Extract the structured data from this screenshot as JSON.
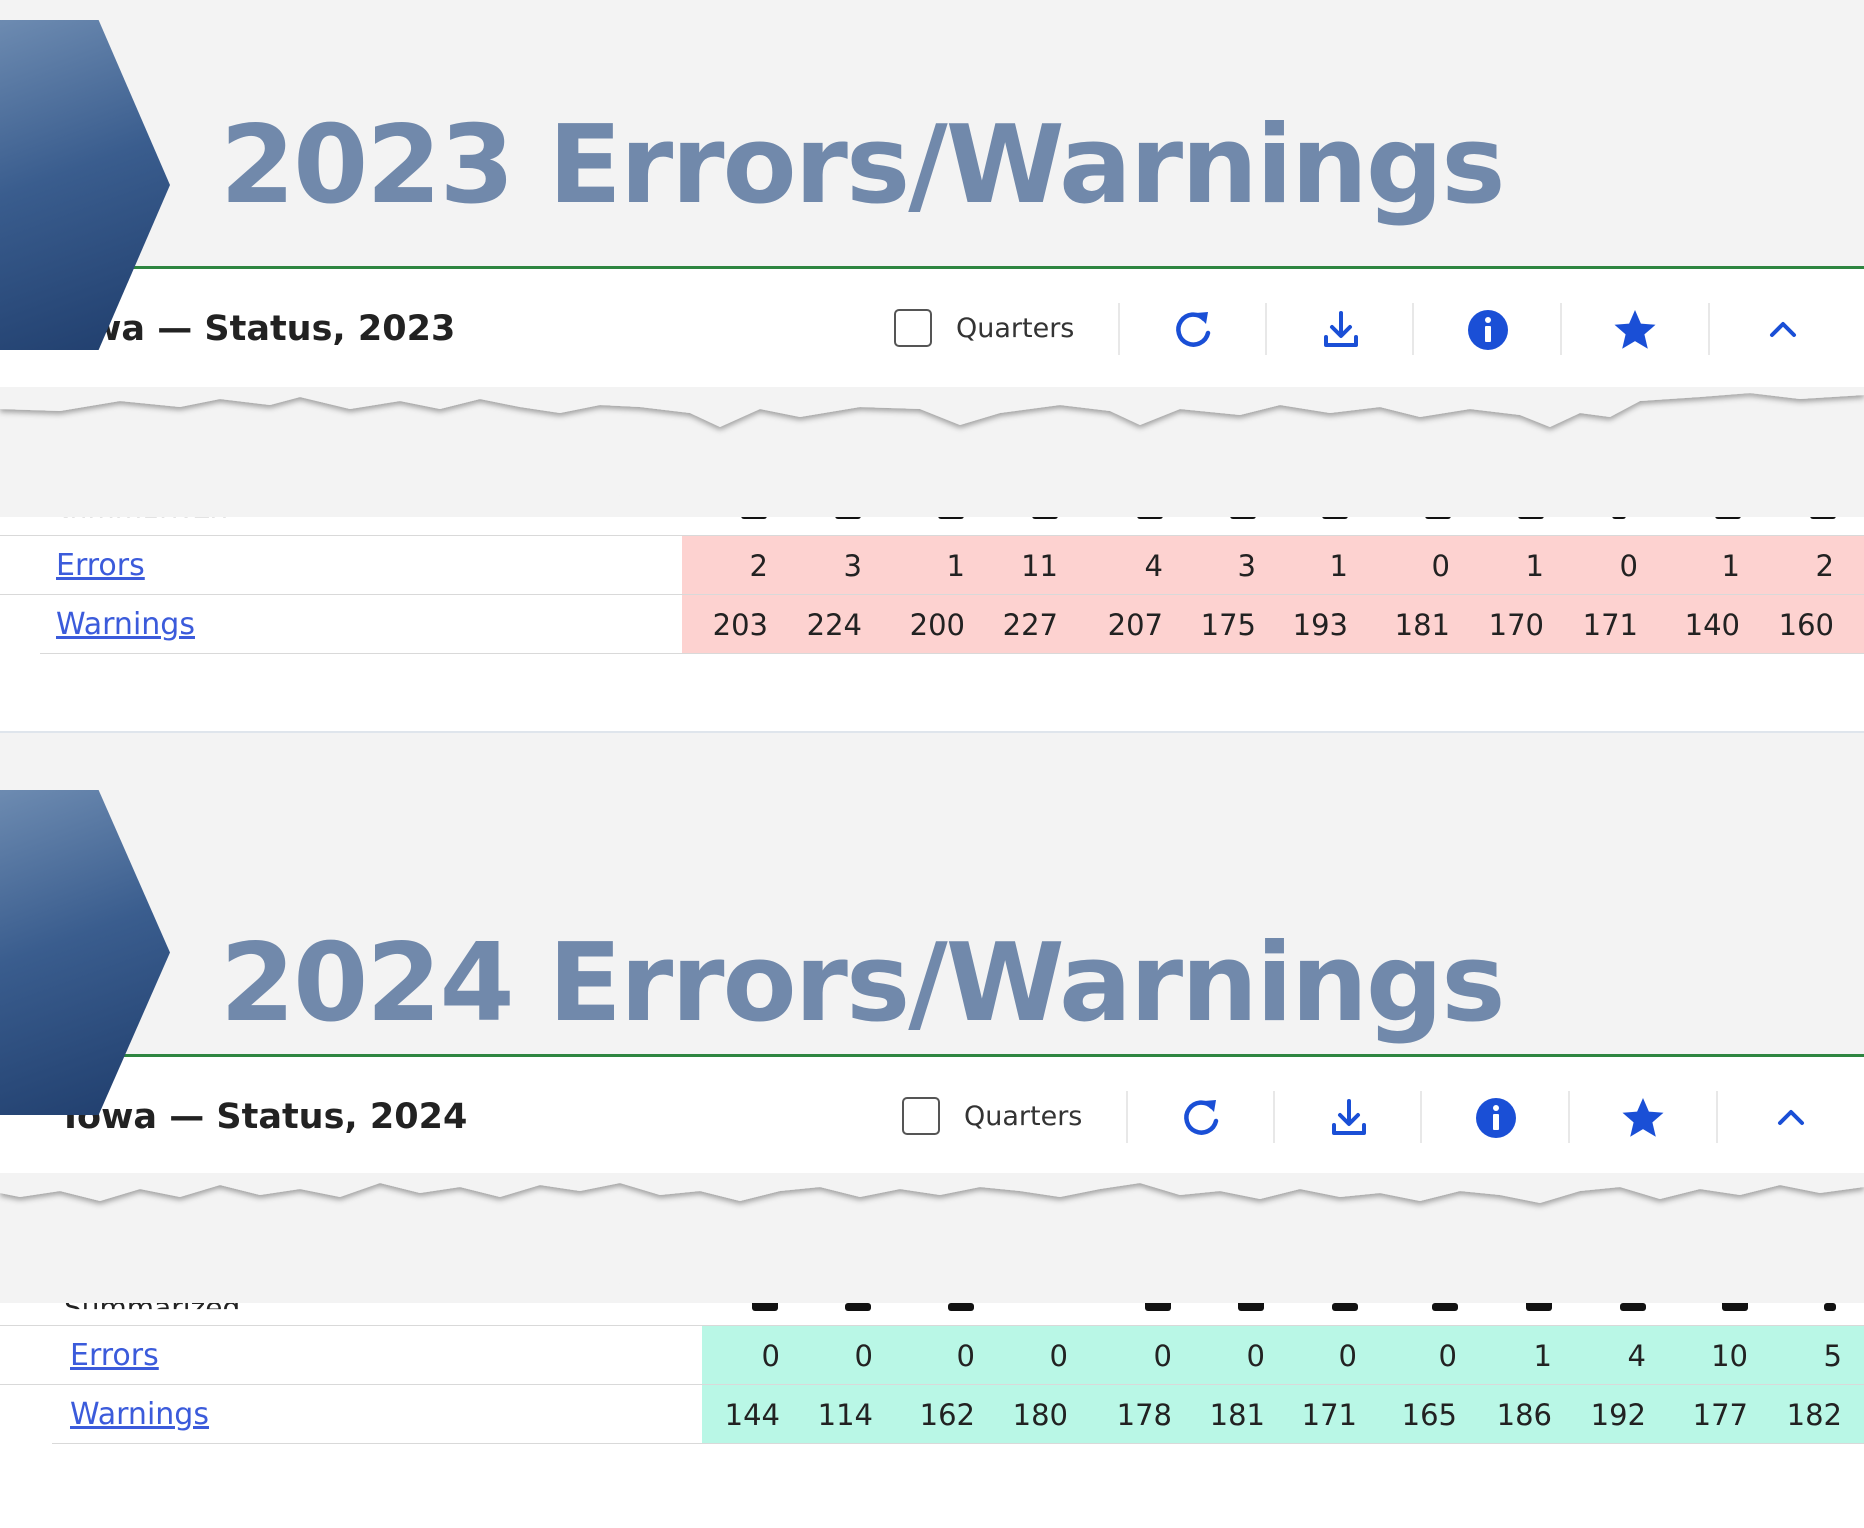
{
  "colors": {
    "heading": "#7189ab",
    "accent_blue": "#1a4fd6",
    "errors_2023_bg": "#fdd2d0",
    "errors_2024_bg": "#b9f7e6",
    "panel_top_border": "#2e8540",
    "link": "#3b5bdb"
  },
  "sections": [
    {
      "heading": "2023 Errors/Warnings",
      "panel_title": "Iowa — Status, 2023",
      "quarters_label": "Quarters",
      "quarters_checked": false,
      "toolbar_icons": [
        "refresh-icon",
        "download-icon",
        "info-icon",
        "star-icon",
        "chevron-up-icon"
      ],
      "partial_label": "Summarized",
      "rows": [
        {
          "label": "Errors",
          "values": [
            "2",
            "3",
            "1",
            "11",
            "4",
            "3",
            "1",
            "0",
            "1",
            "0",
            "1",
            "2"
          ]
        },
        {
          "label": "Warnings",
          "values": [
            "203",
            "224",
            "200",
            "227",
            "207",
            "175",
            "193",
            "181",
            "170",
            "171",
            "140",
            "160"
          ]
        }
      ]
    },
    {
      "heading": "2024 Errors/Warnings",
      "panel_title": "Iowa — Status, 2024",
      "quarters_label": "Quarters",
      "quarters_checked": false,
      "toolbar_icons": [
        "refresh-icon",
        "download-icon",
        "info-icon",
        "star-icon",
        "chevron-up-icon"
      ],
      "partial_label": "Summarized",
      "rows": [
        {
          "label": "Errors",
          "values": [
            "0",
            "0",
            "0",
            "0",
            "0",
            "0",
            "0",
            "0",
            "1",
            "4",
            "10",
            "5"
          ]
        },
        {
          "label": "Warnings",
          "values": [
            "144",
            "114",
            "162",
            "180",
            "178",
            "181",
            "171",
            "165",
            "186",
            "192",
            "177",
            "182"
          ]
        }
      ]
    }
  ]
}
